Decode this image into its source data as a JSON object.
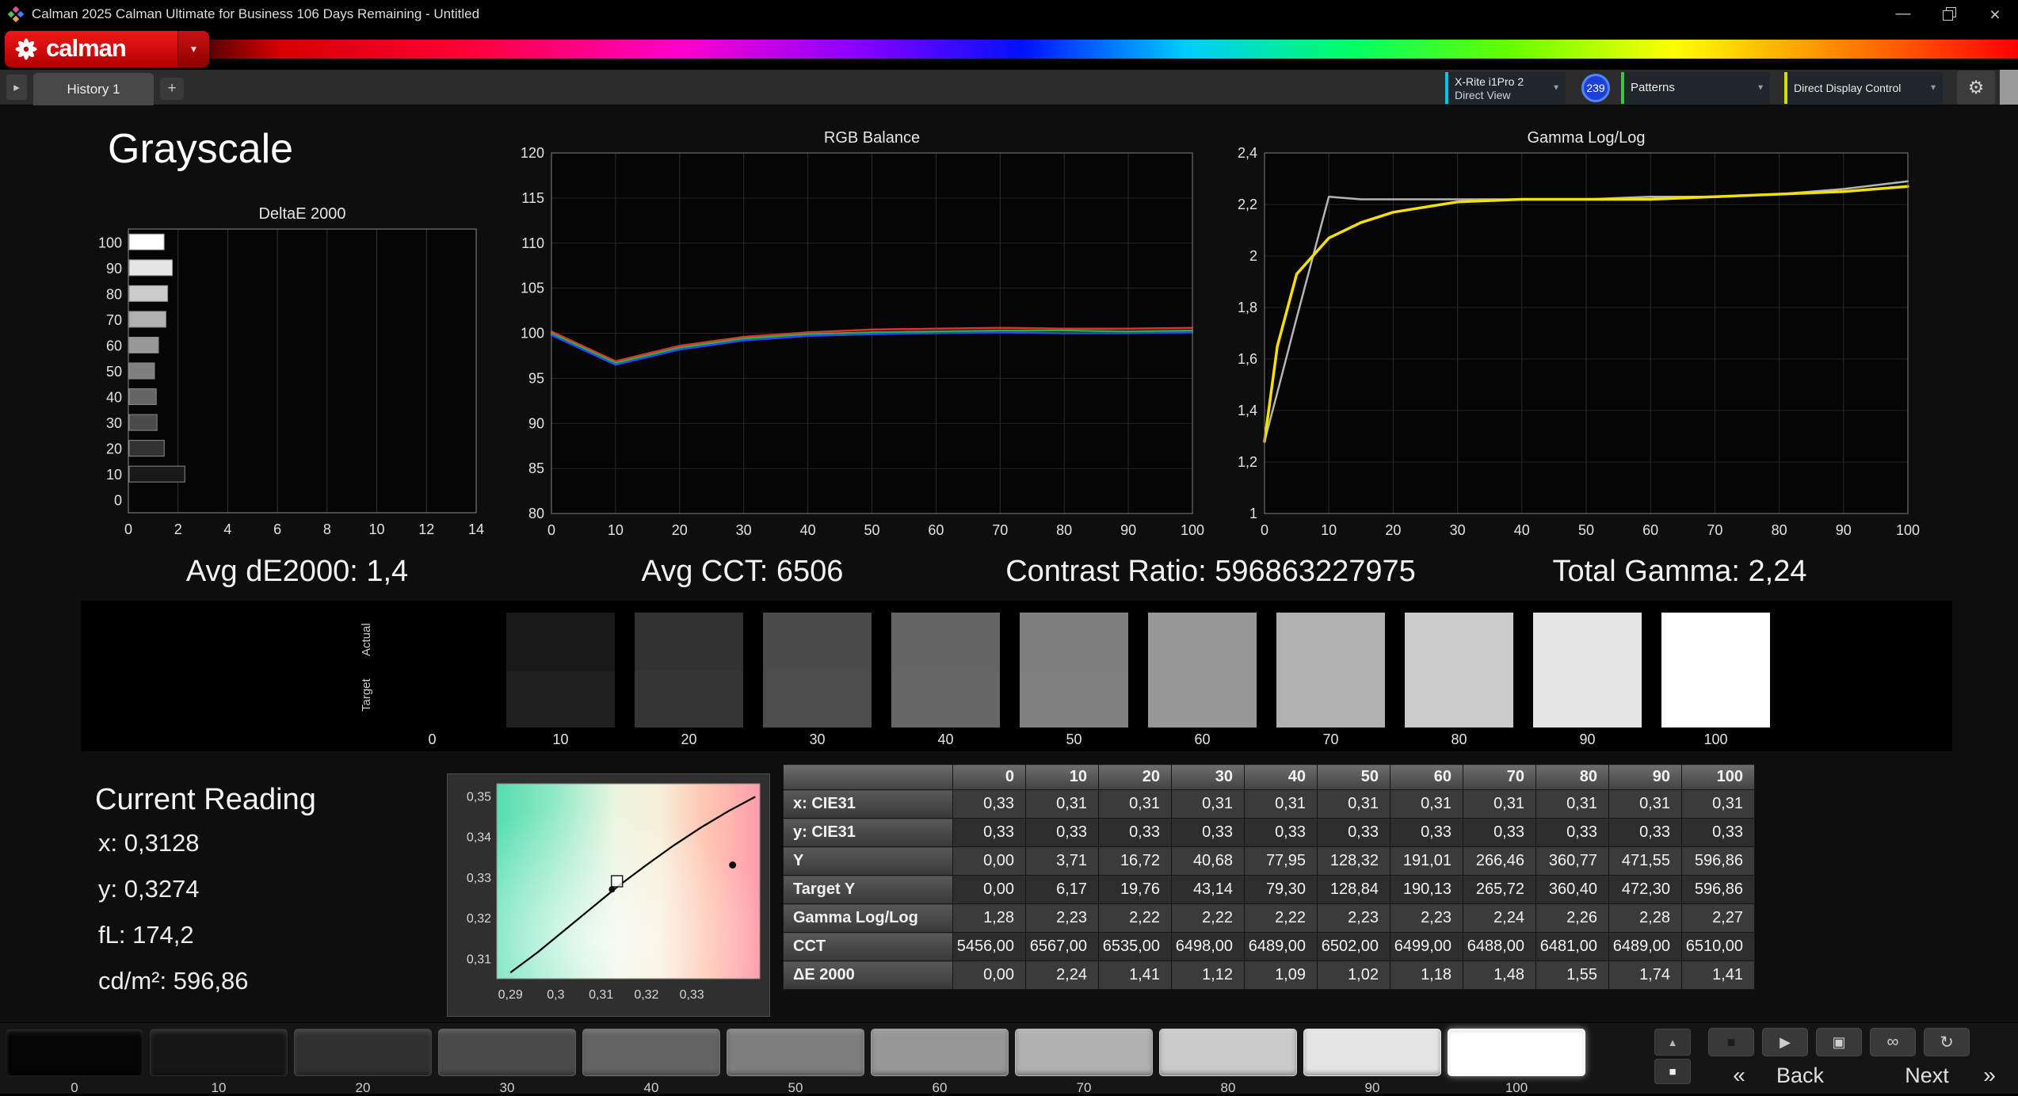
{
  "window": {
    "title": "Calman 2025 Calman Ultimate for Business 106 Days Remaining  - Untitled"
  },
  "brand": {
    "logo_text": "calman"
  },
  "tabs": {
    "history": "History 1"
  },
  "toolbar": {
    "meter_line1": "X-Rite i1Pro 2",
    "meter_line2": "Direct View",
    "badge": "239",
    "patterns": "Patterns",
    "display_control": "Direct Display Control"
  },
  "heading": "Grayscale",
  "stats": {
    "avg_de": "Avg dE2000: 1,4",
    "avg_cct": "Avg CCT: 6506",
    "contrast": "Contrast Ratio: 596863227975",
    "total_gamma": "Total Gamma: 2,24"
  },
  "swatch_strip": {
    "row_labels": [
      "Actual",
      "Target"
    ],
    "levels": [
      "0",
      "10",
      "20",
      "30",
      "40",
      "50",
      "60",
      "70",
      "80",
      "90",
      "100"
    ],
    "actual_colors": [
      "#000000",
      "#191919",
      "#323232",
      "#4b4b4b",
      "#656565",
      "#7f7f7f",
      "#989898",
      "#b1b1b1",
      "#cbcbcb",
      "#e5e5e5",
      "#ffffff"
    ],
    "target_colors": [
      "#000000",
      "#202020",
      "#363636",
      "#4d4d4d",
      "#666666",
      "#808080",
      "#989898",
      "#b1b1b1",
      "#cbcbcb",
      "#e5e5e5",
      "#ffffff"
    ]
  },
  "current_reading": {
    "heading": "Current Reading",
    "lines": [
      "x: 0,3128",
      "y: 0,3274",
      "fL: 174,2",
      "cd/m²: 596,86"
    ]
  },
  "table": {
    "columns": [
      "0",
      "10",
      "20",
      "30",
      "40",
      "50",
      "60",
      "70",
      "80",
      "90",
      "100"
    ],
    "rows": [
      {
        "label": "x: CIE31",
        "values": [
          "0,33",
          "0,31",
          "0,31",
          "0,31",
          "0,31",
          "0,31",
          "0,31",
          "0,31",
          "0,31",
          "0,31",
          "0,31"
        ]
      },
      {
        "label": "y: CIE31",
        "values": [
          "0,33",
          "0,33",
          "0,33",
          "0,33",
          "0,33",
          "0,33",
          "0,33",
          "0,33",
          "0,33",
          "0,33",
          "0,33"
        ]
      },
      {
        "label": "Y",
        "values": [
          "0,00",
          "3,71",
          "16,72",
          "40,68",
          "77,95",
          "128,32",
          "191,01",
          "266,46",
          "360,77",
          "471,55",
          "596,86"
        ]
      },
      {
        "label": "Target Y",
        "values": [
          "0,00",
          "6,17",
          "19,76",
          "43,14",
          "79,30",
          "128,84",
          "190,13",
          "265,72",
          "360,40",
          "472,30",
          "596,86"
        ]
      },
      {
        "label": "Gamma Log/Log",
        "values": [
          "1,28",
          "2,23",
          "2,22",
          "2,22",
          "2,22",
          "2,23",
          "2,23",
          "2,24",
          "2,26",
          "2,28",
          "2,27"
        ]
      },
      {
        "label": "CCT",
        "values": [
          "5456,00",
          "6567,00",
          "6535,00",
          "6498,00",
          "6489,00",
          "6502,00",
          "6499,00",
          "6488,00",
          "6481,00",
          "6489,00",
          "6510,00"
        ]
      },
      {
        "label": "ΔE 2000",
        "values": [
          "0,00",
          "2,24",
          "1,41",
          "1,12",
          "1,09",
          "1,02",
          "1,18",
          "1,48",
          "1,55",
          "1,74",
          "1,41"
        ]
      }
    ]
  },
  "bottom_bar": {
    "patch_labels": [
      "0",
      "10",
      "20",
      "30",
      "40",
      "50",
      "60",
      "70",
      "80",
      "90",
      "100"
    ],
    "patch_colors": [
      "#050505",
      "#161616",
      "#303030",
      "#4a4a4a",
      "#646464",
      "#7e7e7e",
      "#979797",
      "#b0b0b0",
      "#cacaca",
      "#e4e4e4",
      "#ffffff"
    ],
    "selected_patch": "100",
    "back": "Back",
    "next": "Next"
  },
  "icons": {
    "dropdown_arrow": "▼",
    "gear": "⚙",
    "tab_toggle": "▸",
    "add_tab": "+",
    "pattern_up": "▲",
    "pattern_window": "■",
    "prev": "«",
    "next": "»",
    "minimize": "—",
    "close": "×",
    "transport": [
      {
        "name": "stop",
        "glyph": "■"
      },
      {
        "name": "play",
        "glyph": "▶"
      },
      {
        "name": "save",
        "glyph": "▣"
      },
      {
        "name": "loop",
        "glyph": "∞"
      },
      {
        "name": "refresh",
        "glyph": "↻"
      }
    ]
  },
  "chart_data": [
    {
      "id": "deltae",
      "type": "bar",
      "orientation": "horizontal",
      "title": "DeltaE 2000",
      "categories": [
        "100",
        "90",
        "80",
        "70",
        "60",
        "50",
        "40",
        "30",
        "20",
        "10",
        "0"
      ],
      "values": [
        1.41,
        1.74,
        1.55,
        1.48,
        1.18,
        1.02,
        1.09,
        1.12,
        1.41,
        2.24,
        0.0
      ],
      "bar_colors": [
        "#ffffff",
        "#e5e5e5",
        "#cbcbcb",
        "#b1b1b1",
        "#989898",
        "#7f7f7f",
        "#656565",
        "#4b4b4b",
        "#323232",
        "#191919",
        "#000000"
      ],
      "xlim": [
        0,
        14
      ],
      "xticks": [
        0,
        2,
        4,
        6,
        8,
        10,
        12,
        14
      ],
      "grid": true
    },
    {
      "id": "rgb_balance",
      "type": "line",
      "title": "RGB Balance",
      "x": [
        0,
        10,
        20,
        30,
        40,
        50,
        60,
        70,
        80,
        90,
        100
      ],
      "series": [
        {
          "name": "red",
          "color": "#e03030",
          "values": [
            100.2,
            96.9,
            98.6,
            99.6,
            100.1,
            100.4,
            100.5,
            100.6,
            100.5,
            100.5,
            100.6
          ]
        },
        {
          "name": "green",
          "color": "#30b030",
          "values": [
            100.0,
            96.7,
            98.4,
            99.4,
            99.9,
            100.1,
            100.2,
            100.3,
            100.3,
            100.2,
            100.3
          ]
        },
        {
          "name": "blue",
          "color": "#2848ff",
          "values": [
            99.8,
            96.5,
            98.2,
            99.2,
            99.7,
            99.9,
            100.0,
            100.1,
            100.0,
            100.0,
            100.1
          ]
        }
      ],
      "xlim": [
        0,
        100
      ],
      "ylim": [
        80,
        120
      ],
      "yticks": [
        80,
        85,
        90,
        95,
        100,
        105,
        110,
        115,
        120
      ],
      "xticks": [
        0,
        10,
        20,
        30,
        40,
        50,
        60,
        70,
        80,
        90,
        100
      ],
      "grid": true
    },
    {
      "id": "gamma",
      "type": "line",
      "title": "Gamma Log/Log",
      "x": [
        0,
        2,
        5,
        10,
        15,
        20,
        30,
        40,
        50,
        60,
        70,
        80,
        90,
        100
      ],
      "series": [
        {
          "name": "target",
          "color": "#b4b4b4",
          "values": [
            1.28,
            1.47,
            1.76,
            2.23,
            2.22,
            2.22,
            2.22,
            2.22,
            2.22,
            2.23,
            2.23,
            2.24,
            2.26,
            2.29
          ]
        },
        {
          "name": "measured",
          "color": "#f5e000",
          "values": [
            1.28,
            1.65,
            1.93,
            2.07,
            2.13,
            2.17,
            2.21,
            2.22,
            2.22,
            2.22,
            2.23,
            2.24,
            2.25,
            2.27
          ]
        }
      ],
      "xlim": [
        0,
        100
      ],
      "ylim": [
        1,
        2.4
      ],
      "yticks": [
        1,
        1.2,
        1.4,
        1.6,
        1.8,
        2,
        2.2,
        2.4
      ],
      "ytick_labels": [
        "1",
        "1,2",
        "1,4",
        "1,6",
        "1,8",
        "2",
        "2,2",
        "2,4"
      ],
      "xticks": [
        0,
        10,
        20,
        30,
        40,
        50,
        60,
        70,
        80,
        90,
        100
      ],
      "grid": true
    },
    {
      "id": "cie",
      "type": "scatter",
      "title": "CIE 1931 chromaticity",
      "xlim": [
        0.287,
        0.345
      ],
      "ylim": [
        0.305,
        0.353
      ],
      "xticks": [
        0.29,
        0.3,
        0.31,
        0.32,
        0.33
      ],
      "xtick_labels": [
        "0,29",
        "0,3",
        "0,31",
        "0,32",
        "0,33"
      ],
      "yticks": [
        0.31,
        0.32,
        0.33,
        0.34,
        0.35
      ],
      "ytick_labels": [
        "0,31",
        "0,32",
        "0,33",
        "0,34",
        "0,35"
      ],
      "locus": [
        [
          0.29,
          0.3065
        ],
        [
          0.296,
          0.3115
        ],
        [
          0.302,
          0.317
        ],
        [
          0.308,
          0.3225
        ],
        [
          0.314,
          0.328
        ],
        [
          0.32,
          0.333
        ],
        [
          0.326,
          0.3378
        ],
        [
          0.332,
          0.3422
        ],
        [
          0.338,
          0.3462
        ],
        [
          0.344,
          0.3498
        ]
      ],
      "points": [
        {
          "x": 0.3135,
          "y": 0.329,
          "marker": "square"
        },
        {
          "x": 0.3124,
          "y": 0.327,
          "marker": "dot-small"
        },
        {
          "x": 0.339,
          "y": 0.333,
          "marker": "dot"
        }
      ]
    }
  ]
}
